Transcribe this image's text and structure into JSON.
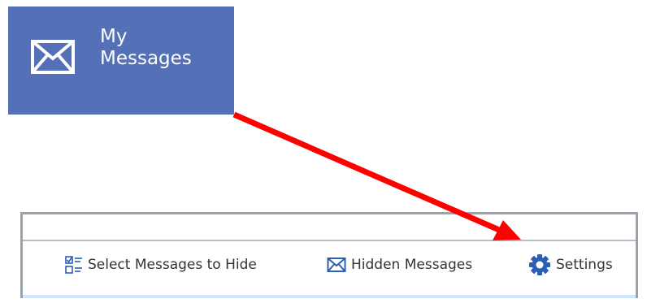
{
  "tile": {
    "label_line1": "My",
    "label_line2": "Messages",
    "icon": "envelope-icon",
    "background": "#5470b6"
  },
  "toolbar": {
    "items": [
      {
        "label": "Select Messages to Hide",
        "icon": "checklist-icon"
      },
      {
        "label": "Hidden Messages",
        "icon": "envelope-icon"
      },
      {
        "label": "Settings",
        "icon": "gear-icon"
      }
    ]
  },
  "colors": {
    "icon_blue": "#2b5fb3",
    "arrow_red": "#ff0000"
  }
}
